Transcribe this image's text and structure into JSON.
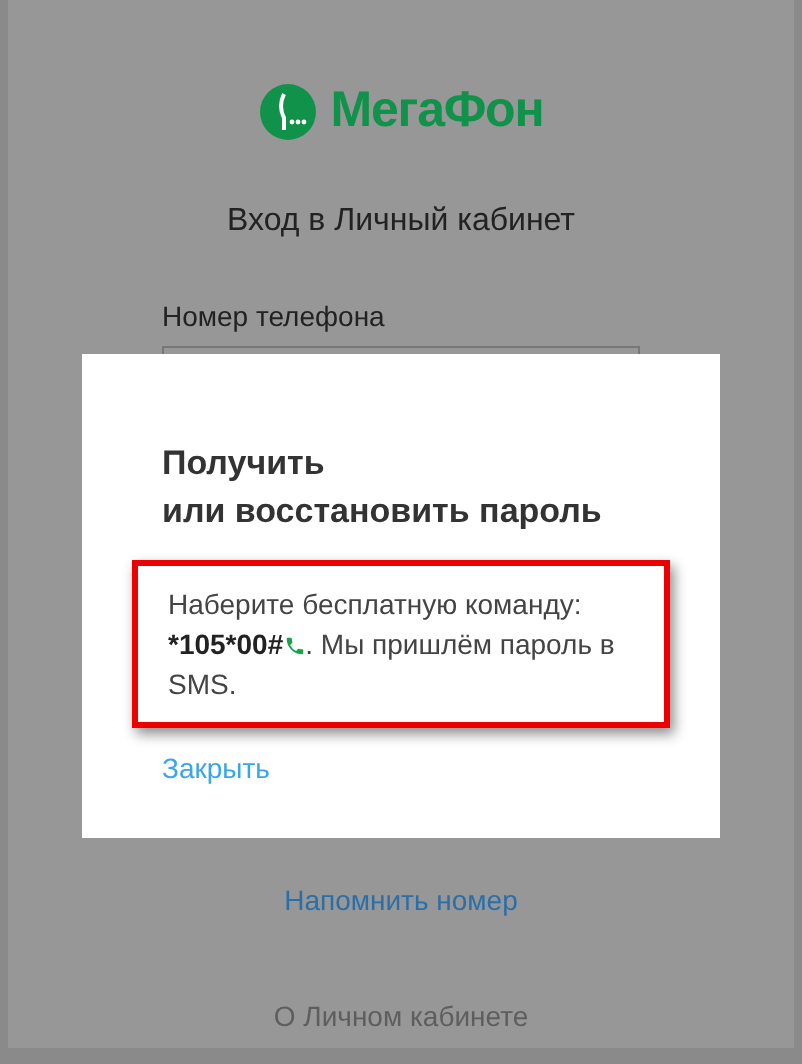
{
  "brand": {
    "logo_text": "МегаФон"
  },
  "login": {
    "title": "Вход в Личный кабинет",
    "phone_label": "Номер телефона"
  },
  "dialog": {
    "title_lines": [
      "Получить",
      "или восстановить пароль"
    ],
    "instruction": {
      "before": "Наберите бесплатную команду:",
      "code": "*105*00#",
      "after": ". Мы пришлём пароль в SMS.",
      "highlighted": true
    },
    "close_link": "Закрыть"
  },
  "links": [
    {
      "kind": "link",
      "text": "Напомнить номер"
    },
    {
      "kind": "muted",
      "text": "О Личном кабинете"
    }
  ]
}
